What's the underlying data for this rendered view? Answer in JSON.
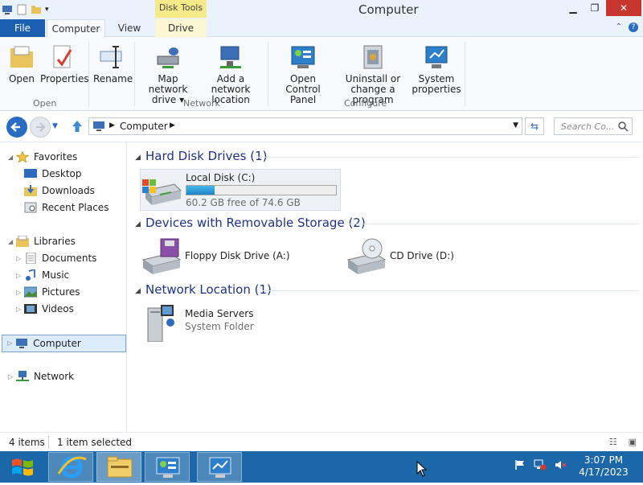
{
  "window": {
    "title": "Computer",
    "context_tab_group": "Disk Tools"
  },
  "tabs": {
    "file": "File",
    "computer": "Computer",
    "view": "View",
    "drive": "Drive"
  },
  "ribbon": {
    "open": {
      "label": "Open"
    },
    "properties": {
      "label": "Properties"
    },
    "rename": {
      "label": "Rename"
    },
    "map_network_drive": {
      "line1": "Map network",
      "line2": "drive ▾"
    },
    "add_network_location": {
      "line1": "Add a network",
      "line2": "location"
    },
    "open_control_panel": {
      "line1": "Open Control",
      "line2": "Panel"
    },
    "uninstall": {
      "line1": "Uninstall or",
      "line2": "change a program"
    },
    "system_properties": {
      "line1": "System",
      "line2": "properties"
    },
    "groups": {
      "open": "Open",
      "network": "Network",
      "configure": "Configure"
    }
  },
  "navbar": {
    "address": "Computer",
    "search_placeholder": "Search Co..."
  },
  "nav": {
    "favorites": "Favorites",
    "desktop": "Desktop",
    "downloads": "Downloads",
    "recent_places": "Recent Places",
    "libraries": "Libraries",
    "documents": "Documents",
    "music": "Music",
    "pictures": "Pictures",
    "videos": "Videos",
    "computer": "Computer",
    "network": "Network"
  },
  "content": {
    "hdd_section": "Hard Disk Drives (1)",
    "local_disk": {
      "name": "Local Disk (C:)",
      "free": "60.2 GB free of 74.6 GB",
      "used_fraction": 0.19
    },
    "removable_section": "Devices with Removable Storage (2)",
    "floppy": "Floppy Disk Drive (A:)",
    "cd": "CD Drive (D:)",
    "network_section": "Network Location (1)",
    "media_servers": {
      "name": "Media Servers",
      "sub": "System Folder"
    }
  },
  "status": {
    "items": "4 items",
    "selected": "1 item selected"
  },
  "taskbar": {
    "time": "3:07 PM",
    "date": "4/17/2023"
  },
  "colors": {
    "accent": "#1c5fb0",
    "taskbar": "#1b67a8",
    "section_header": "#1e3287",
    "close": "#c7372f"
  }
}
